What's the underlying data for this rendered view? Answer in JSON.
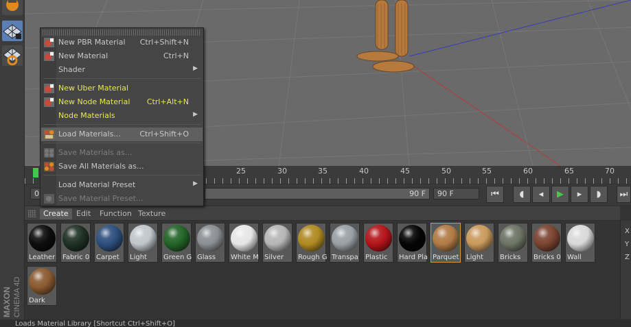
{
  "menu": {
    "items": [
      {
        "label": "New PBR Material",
        "shortcut": "Ctrl+Shift+N"
      },
      {
        "label": "New Material",
        "shortcut": "Ctrl+N"
      },
      {
        "label": "Shader",
        "shortcut": ""
      },
      {
        "label": "New Uber Material",
        "shortcut": ""
      },
      {
        "label": "New Node Material",
        "shortcut": "Ctrl+Alt+N"
      },
      {
        "label": "Node Materials",
        "shortcut": ""
      },
      {
        "label": "Load Materials...",
        "shortcut": "Ctrl+Shift+O"
      },
      {
        "label": "Save Materials as...",
        "shortcut": ""
      },
      {
        "label": "Save All Materials as...",
        "shortcut": ""
      },
      {
        "label": "Load Material Preset",
        "shortcut": ""
      },
      {
        "label": "Save Material Preset...",
        "shortcut": ""
      }
    ]
  },
  "timeline": {
    "ticks": [
      "25",
      "30",
      "35",
      "40",
      "45",
      "50",
      "55",
      "60",
      "65",
      "70"
    ]
  },
  "transport": {
    "start_frame": "0",
    "slider_end": "90 F",
    "end_frame": "90 F"
  },
  "material_manager": {
    "tabs": [
      "Create",
      "Edit",
      "Function",
      "Texture"
    ],
    "active_tab": "Create",
    "materials": [
      {
        "label": "Leather",
        "color": "#0d0d0d"
      },
      {
        "label": "Fabric 0",
        "color": "#1f3124"
      },
      {
        "label": "Carpet",
        "color": "#2d4f7e"
      },
      {
        "label": "Light",
        "color": "#bfc6cc"
      },
      {
        "label": "Green G",
        "color": "#236428"
      },
      {
        "label": "Glass",
        "color": "#8b8f93"
      },
      {
        "label": "White M",
        "color": "#e6e6e6"
      },
      {
        "label": "Silver",
        "color": "#b6b6b6"
      },
      {
        "label": "Rough G",
        "color": "#b08a23"
      },
      {
        "label": "Transpa",
        "color": "#9aa0a6"
      },
      {
        "label": "Plastic",
        "color": "#b3141a"
      },
      {
        "label": "Hard Pla",
        "color": "#050505"
      },
      {
        "label": "Parquet",
        "color": "#b07a45"
      },
      {
        "label": "Light",
        "color": "#c99a5c"
      },
      {
        "label": "Bricks",
        "color": "#6e7464"
      },
      {
        "label": "Bricks 0",
        "color": "#7b4431"
      },
      {
        "label": "Wall",
        "color": "#d9d9d9"
      },
      {
        "label": "Dark",
        "color": "#8a5a30"
      }
    ]
  },
  "right_panel": {
    "axes": [
      "X",
      "Y",
      "Z"
    ]
  },
  "logo": {
    "brand": "MAXON",
    "product": "CINEMA 4D"
  },
  "status_bar": "Loads Material Library [Shortcut Ctrl+Shift+O]"
}
